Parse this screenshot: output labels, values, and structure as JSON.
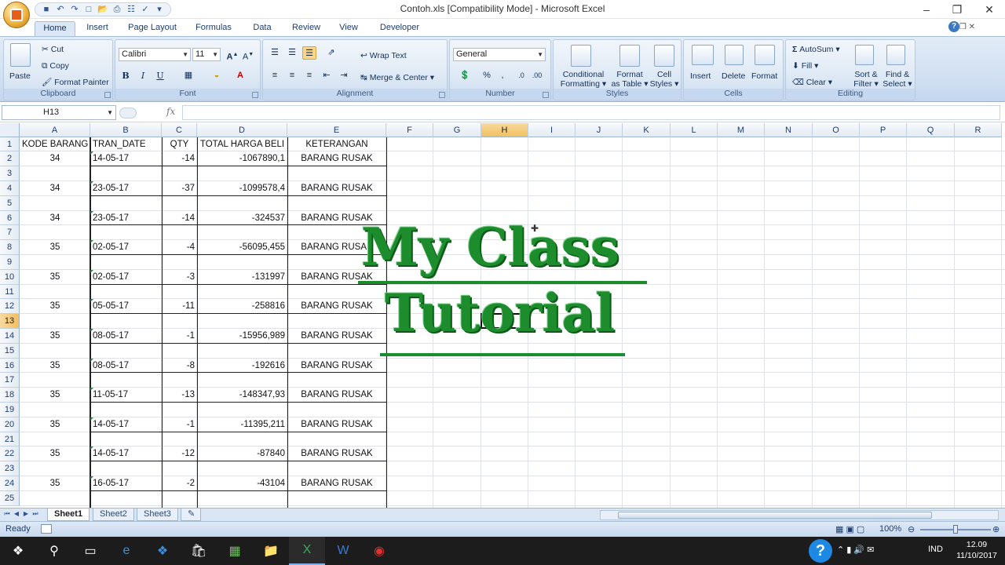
{
  "window": {
    "title": "Contoh.xls  [Compatibility Mode] - Microsoft Excel"
  },
  "ribbon_tabs": [
    "Home",
    "Insert",
    "Page Layout",
    "Formulas",
    "Data",
    "Review",
    "View",
    "Developer"
  ],
  "clipboard": {
    "paste": "Paste",
    "cut": "Cut",
    "copy": "Copy",
    "format_painter": "Format Painter",
    "label": "Clipboard"
  },
  "font": {
    "family": "Calibri",
    "size": "11",
    "label": "Font",
    "bold": "B",
    "italic": "I",
    "underline": "U"
  },
  "alignment": {
    "wrap_text": "Wrap Text",
    "merge_center": "Merge & Center",
    "label": "Alignment"
  },
  "number": {
    "format": "General",
    "label": "Number"
  },
  "styles": {
    "conditional_1": "Conditional",
    "conditional_2": "Formatting",
    "format_table_1": "Format",
    "format_table_2": "as Table",
    "cell_styles_1": "Cell",
    "cell_styles_2": "Styles",
    "label": "Styles"
  },
  "cells": {
    "insert": "Insert",
    "delete": "Delete",
    "format": "Format",
    "label": "Cells"
  },
  "editing": {
    "autosum": "AutoSum",
    "fill": "Fill",
    "clear": "Clear",
    "sort_1": "Sort &",
    "sort_2": "Filter",
    "find_1": "Find &",
    "find_2": "Select",
    "label": "Editing"
  },
  "formula_bar": {
    "name_box": "H13",
    "fx": "fx",
    "formula": ""
  },
  "columns": [
    "A",
    "B",
    "C",
    "D",
    "E",
    "F",
    "G",
    "H",
    "I",
    "J",
    "K",
    "L",
    "M",
    "N",
    "O",
    "P",
    "Q",
    "R"
  ],
  "rows": [
    "1",
    "2",
    "3",
    "4",
    "5",
    "6",
    "7",
    "8",
    "9",
    "10",
    "11",
    "12",
    "13",
    "14",
    "15",
    "16",
    "17",
    "18",
    "19",
    "20",
    "21",
    "22",
    "23",
    "24",
    "25"
  ],
  "header_row": [
    "KODE BARANG",
    "TRAN_DATE",
    "QTY",
    "TOTAL HARGA BELI",
    "KETERANGAN"
  ],
  "data_rows": [
    {
      "row": 2,
      "kode": "34",
      "date": "14-05-17",
      "qty": "-14",
      "total": "-1067890,1",
      "ket": "BARANG RUSAK"
    },
    {
      "row": 4,
      "kode": "34",
      "date": "23-05-17",
      "qty": "-37",
      "total": "-1099578,4",
      "ket": "BARANG RUSAK"
    },
    {
      "row": 6,
      "kode": "34",
      "date": "23-05-17",
      "qty": "-14",
      "total": "-324537",
      "ket": "BARANG RUSAK"
    },
    {
      "row": 8,
      "kode": "35",
      "date": "02-05-17",
      "qty": "-4",
      "total": "-56095,455",
      "ket": "BARANG RUSAK"
    },
    {
      "row": 10,
      "kode": "35",
      "date": "02-05-17",
      "qty": "-3",
      "total": "-131997",
      "ket": "BARANG RUSAK"
    },
    {
      "row": 12,
      "kode": "35",
      "date": "05-05-17",
      "qty": "-11",
      "total": "-258816",
      "ket": "BARANG RUSAK"
    },
    {
      "row": 14,
      "kode": "35",
      "date": "08-05-17",
      "qty": "-1",
      "total": "-15956,989",
      "ket": "BARANG RUSAK"
    },
    {
      "row": 16,
      "kode": "35",
      "date": "08-05-17",
      "qty": "-8",
      "total": "-192616",
      "ket": "BARANG RUSAK"
    },
    {
      "row": 18,
      "kode": "35",
      "date": "11-05-17",
      "qty": "-13",
      "total": "-148347,93",
      "ket": "BARANG RUSAK"
    },
    {
      "row": 20,
      "kode": "35",
      "date": "14-05-17",
      "qty": "-1",
      "total": "-11395,211",
      "ket": "BARANG RUSAK"
    },
    {
      "row": 22,
      "kode": "35",
      "date": "14-05-17",
      "qty": "-12",
      "total": "-87840",
      "ket": "BARANG RUSAK"
    },
    {
      "row": 24,
      "kode": "35",
      "date": "16-05-17",
      "qty": "-2",
      "total": "-43104",
      "ket": "BARANG RUSAK"
    }
  ],
  "selected": {
    "column": "H",
    "row": "13"
  },
  "watermark": {
    "line1": "My Class",
    "line2": "Tutorial",
    "color": "#1c8c2c"
  },
  "sheet_tabs": [
    "Sheet1",
    "Sheet2",
    "Sheet3"
  ],
  "status": {
    "ready": "Ready",
    "zoom": "100%"
  },
  "taskbar": {
    "language": "IND",
    "time": "12.09",
    "date": "11/10/2017"
  },
  "colors": {
    "ribbon": "#dce7f5",
    "accent": "#2b5797",
    "selected_header": "#f1c15f"
  }
}
